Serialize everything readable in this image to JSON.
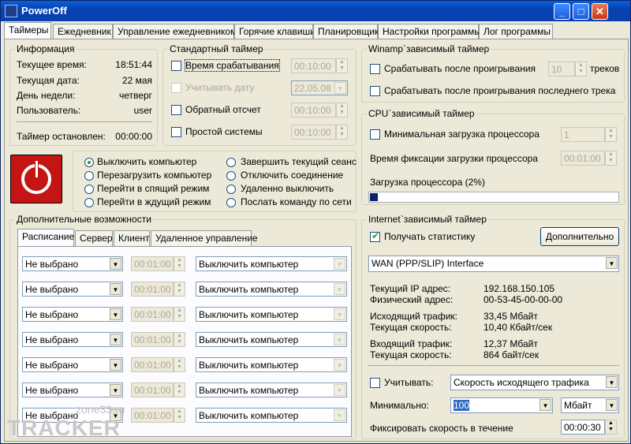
{
  "title": "PowerOff",
  "tabs": [
    "Таймеры",
    "Ежедневник",
    "Управление ежедневником",
    "Горячие клавиши",
    "Планировщик",
    "Настройки программы",
    "Лог программы"
  ],
  "info": {
    "title": "Информация",
    "time_label": "Текущее время:",
    "time": "18:51:44",
    "date_label": "Текущая дата:",
    "date": "22 мая",
    "weekday_label": "День недели:",
    "weekday": "четверг",
    "user_label": "Пользователь:",
    "user": "user",
    "stopped_label": "Таймер остановлен:",
    "stopped": "00:00:00"
  },
  "std": {
    "title": "Стандартный таймер",
    "trigger_label": "Время срабатывания",
    "trigger": "00:10:00",
    "date_label": "Учитывать дату",
    "date": "22.05.08",
    "countdown_label": "Обратный отсчет",
    "countdown": "00:10:00",
    "idle_label": "Простой системы",
    "idle": "00:10:00"
  },
  "actions": [
    "Выключить компьютер",
    "Перезагрузить компьютер",
    "Перейти в спящий режим",
    "Перейти в ждущий режим",
    "Завершить текущий сеанс",
    "Отключить соединение",
    "Удаленно выключить",
    "Послать команду по сети"
  ],
  "winamp": {
    "title": "Winamp`зависимый таймер",
    "after_label": "Срабатывать после проигрывания",
    "tracks": "10",
    "tracks_label": "треков",
    "last_label": "Срабатывать после проигрывания последнего трека"
  },
  "cpu": {
    "title": "CPU`зависимый таймер",
    "min_label": "Минимальная загрузка процессора",
    "min": "1",
    "fix_label": "Время фиксации загрузки процессора",
    "fix": "00:01:00",
    "load_label": "Загрузка процессора (2%)",
    "load": 0.02
  },
  "extra": {
    "title": "Дополнительные возможности",
    "tabs": [
      "Расписание",
      "Сервер",
      "Клиент",
      "Удаленное управление"
    ],
    "rows": [
      {
        "day": "Не выбрано",
        "time": "00:01:00",
        "action": "Выключить компьютер"
      },
      {
        "day": "Не выбрано",
        "time": "00:01:00",
        "action": "Выключить компьютер"
      },
      {
        "day": "Не выбрано",
        "time": "00:01:00",
        "action": "Выключить компьютер"
      },
      {
        "day": "Не выбрано",
        "time": "00:01:00",
        "action": "Выключить компьютер"
      },
      {
        "day": "Не выбрано",
        "time": "00:01:00",
        "action": "Выключить компьютер"
      },
      {
        "day": "Не выбрано",
        "time": "00:01:00",
        "action": "Выключить компьютер"
      },
      {
        "day": "Не выбрано",
        "time": "00:01:00",
        "action": "Выключить компьютер"
      }
    ]
  },
  "internet": {
    "title": "Internet`зависимый таймер",
    "stats_label": "Получать статистику",
    "more_label": "Дополнительно",
    "iface": "WAN (PPP/SLIP) Interface",
    "ip_label": "Текущий IP адрес:",
    "ip": "192.168.150.105",
    "mac_label": "Физический адрес:",
    "mac": "00-53-45-00-00-00",
    "out_label": "Исходящий трафик:",
    "out": "33,45 Мбайт",
    "out_speed_label": "Текущая скорость:",
    "out_speed": "10,40 Кбайт/сек",
    "in_label": "Входящий трафик:",
    "in": "12,37 Мбайт",
    "in_speed_label": "Текущая скорость:",
    "in_speed": "864 байт/сек",
    "consider_label": "Учитывать:",
    "consider": "Скорость исходящего трафика",
    "min_label": "Минимально:",
    "min": "100",
    "unit": "Мбайт",
    "fix_label": "Фиксировать скорость в течение",
    "fix": "00:00:30"
  },
  "watermark": {
    "site": "zone33.ru",
    "text": "TRACKER"
  },
  "colors": {
    "title_bar": "#0a46b8",
    "power": "#c41414",
    "progress": "#0a246a"
  }
}
